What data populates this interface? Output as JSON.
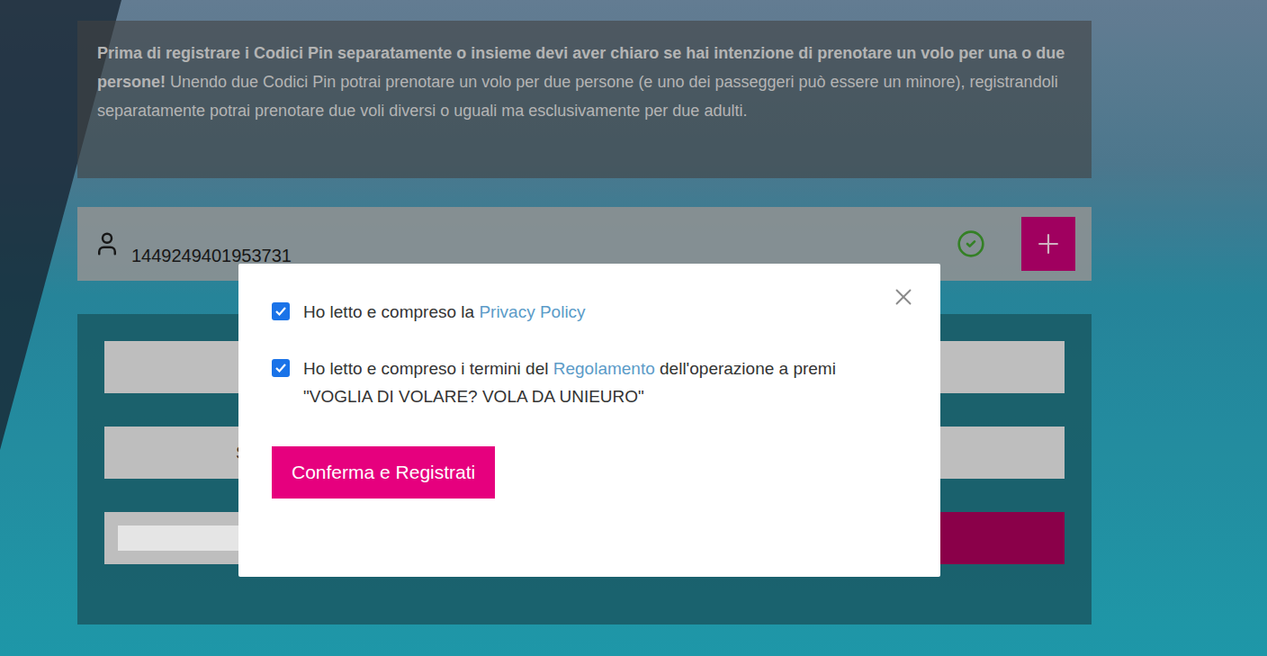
{
  "info": {
    "bold": "Prima di registrare i Codici Pin separatamente o insieme devi aver chiaro se hai intenzione di prenotare un volo per una o due persone!",
    "text": " Unendo due Codici Pin potrai prenotare un volo per due persone (e uno dei passeggeri può essere un minore), registrandoli separatamente potrai prenotare due voli diversi o uguali ma esclusivamente per due adulti."
  },
  "pin_field": {
    "value": "1449249401953731",
    "valid": true
  },
  "form": {
    "hint": "S"
  },
  "modal": {
    "checks": [
      {
        "before": "Ho letto e compreso la ",
        "link": "Privacy Policy",
        "after": "",
        "checked": true
      },
      {
        "before": "Ho letto e compreso i termini del ",
        "link": "Regolamento",
        "after": " dell'operazione a premi \"VOGLIA DI VOLARE? VOLA DA UNIEURO\"",
        "checked": true
      }
    ],
    "button": "Conferma e Registrati"
  }
}
